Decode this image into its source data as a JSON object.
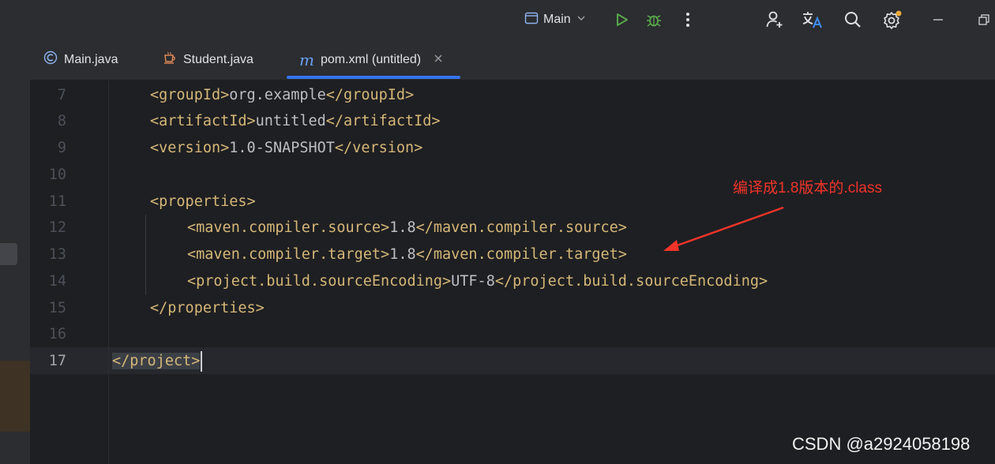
{
  "toolbar": {
    "run_config_label": "Main",
    "icons": [
      "window-icon",
      "chevron-down-icon",
      "run-icon",
      "debug-icon",
      "more-vertical-icon",
      "add-user-icon",
      "translate-icon",
      "search-icon",
      "settings-icon",
      "minimize-icon",
      "maximize-icon"
    ]
  },
  "tabs": [
    {
      "label": "Main.java",
      "icon": "class-icon"
    },
    {
      "label": "Student.java",
      "icon": "java-cup-icon"
    },
    {
      "label": "pom.xml (untitled)",
      "icon": "maven-icon",
      "active": true
    }
  ],
  "editor": {
    "lines": [
      {
        "num": "7",
        "open": "<groupId>",
        "text": "org.example",
        "close": "</groupId>"
      },
      {
        "num": "8",
        "open": "<artifactId>",
        "text": "untitled",
        "close": "</artifactId>"
      },
      {
        "num": "9",
        "open": "<version>",
        "text": "1.0-SNAPSHOT",
        "close": "</version>"
      },
      {
        "num": "10"
      },
      {
        "num": "11",
        "open": "<properties>"
      },
      {
        "num": "12",
        "open": "<maven.compiler.source>",
        "text": "1.8",
        "close": "</maven.compiler.source>"
      },
      {
        "num": "13",
        "open": "<maven.compiler.target>",
        "text": "1.8",
        "close": "</maven.compiler.target>"
      },
      {
        "num": "14",
        "open": "<project.build.sourceEncoding>",
        "text": "UTF-8",
        "close": "</project.build.sourceEncoding>"
      },
      {
        "num": "15",
        "open": "</properties>"
      },
      {
        "num": "16"
      },
      {
        "num": "17",
        "open": "</project>"
      }
    ]
  },
  "annotation": {
    "text": "编译成1.8版本的.class",
    "color": "#f0342a"
  },
  "watermark": "CSDN @a2924058198",
  "colors": {
    "accent": "#3574f0",
    "tag": "#d5b778",
    "text": "#bcbec4",
    "background": "#1e1f22"
  }
}
